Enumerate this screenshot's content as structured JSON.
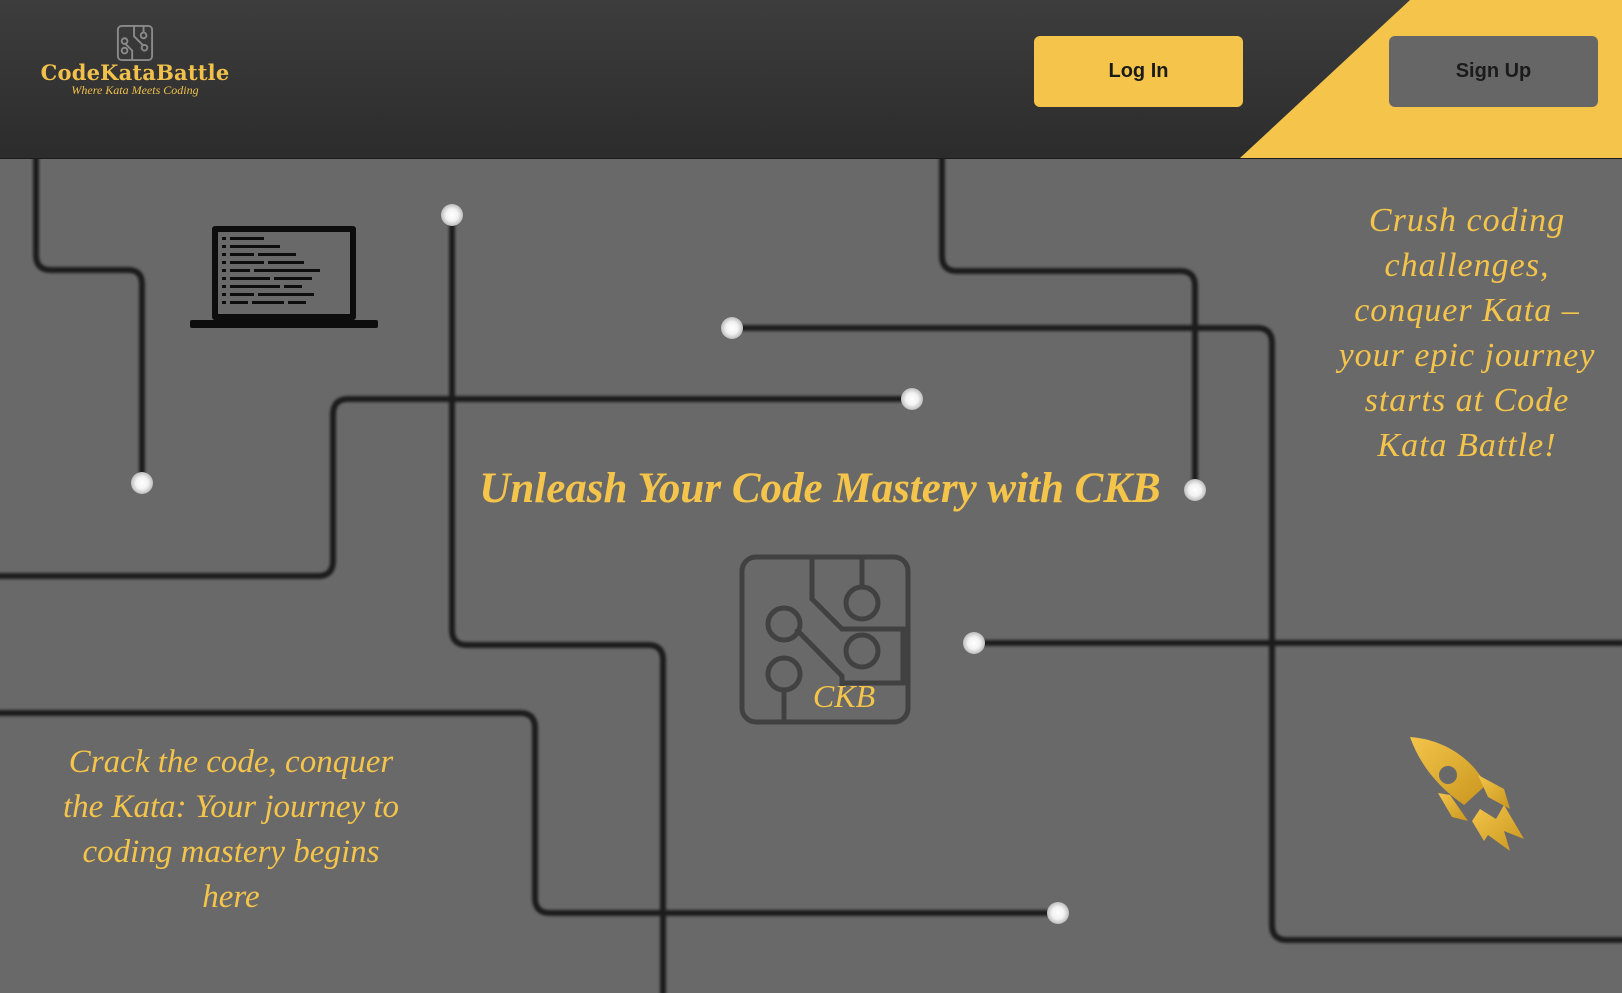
{
  "header": {
    "logo": {
      "icon": "circuit-board-icon",
      "title": "CodeKataBattle",
      "tagline": "Where Kata Meets Coding"
    },
    "login_label": "Log In",
    "signup_label": "Sign Up"
  },
  "main": {
    "hero_title": "Unleash Your Code Mastery with CKB",
    "center_logo": {
      "icon": "circuit-board-icon",
      "text": "CKB"
    },
    "tagline_right": "Crush coding challenges, conquer Kata – your epic journey starts at Code Kata Battle!",
    "tagline_left": "Crack the code, conquer the Kata: Your journey to coding mastery begins here",
    "icons": [
      "laptop-code-icon",
      "circuit-board-icon",
      "rocket-icon"
    ]
  },
  "colors": {
    "accent": "#f4c54a",
    "header_bg": "#333333",
    "page_bg": "#6a6969",
    "signup_bg": "#666666",
    "circuit_line": "#1e1e1e"
  }
}
